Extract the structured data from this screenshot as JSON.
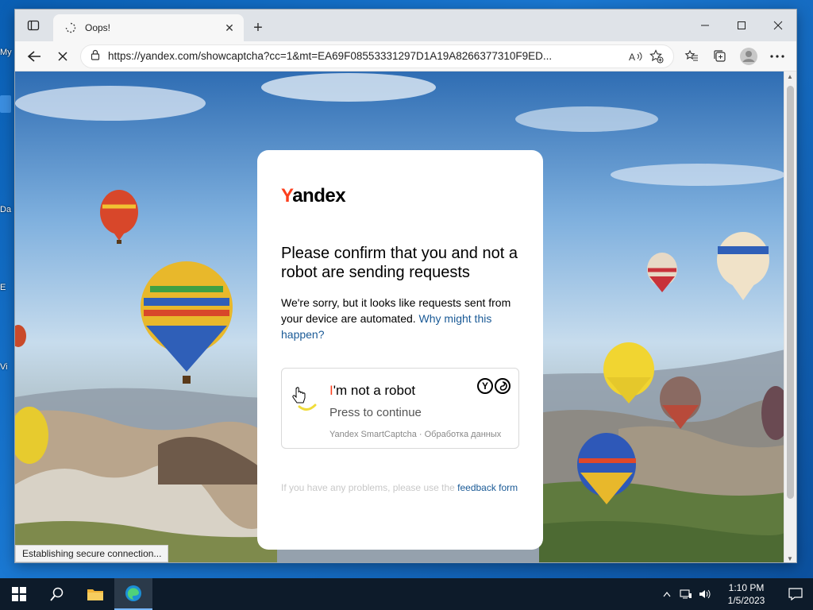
{
  "desktop": {
    "fragments": [
      "My",
      "Da",
      "E",
      "Vi"
    ]
  },
  "browser": {
    "tab": {
      "title": "Oops!"
    },
    "address": {
      "url": "https://yandex.com/showcaptcha?cc=1&mt=EA69F08553331297D1A19A8266377310F9ED..."
    },
    "status": "Establishing secure connection..."
  },
  "captcha": {
    "logo": {
      "first": "Y",
      "rest": "andex"
    },
    "heading": "Please confirm that you and not a robot are sending requests",
    "paragraph": "We're sorry, but it looks like requests sent from your device are automated. ",
    "why_link": "Why might this happen?",
    "checkbox": {
      "title_first": "I",
      "title_rest": "'m not a robot",
      "subtitle": "Press to continue",
      "footer": "Yandex SmartCaptcha · Обработка данных"
    },
    "feedback_text": "If you have any problems, please use the ",
    "feedback_link": "feedback form"
  },
  "taskbar": {
    "time": "1:10 PM",
    "date": "1/5/2023"
  },
  "colors": {
    "yandex_red": "#fc3f1d",
    "link_blue": "#1a5a96"
  }
}
